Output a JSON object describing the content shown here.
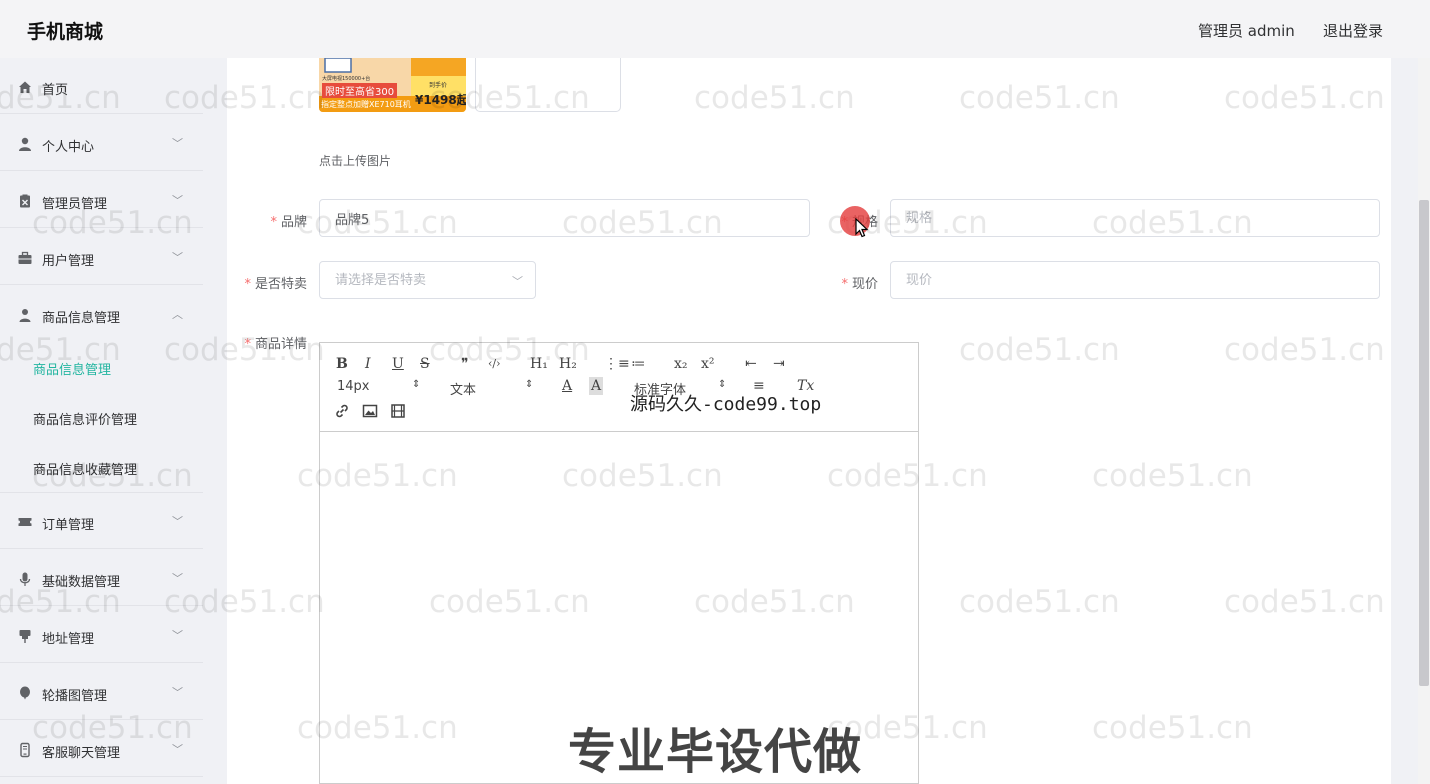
{
  "header": {
    "brand": "手机商城",
    "admin": "管理员 admin",
    "logout": "退出登录"
  },
  "sidebar": {
    "items": [
      {
        "label": "首页",
        "icon": "home-icon",
        "expand": ""
      },
      {
        "label": "个人中心",
        "icon": "user-icon",
        "expand": "﹀"
      },
      {
        "label": "管理员管理",
        "icon": "clipboard-icon",
        "expand": "﹀"
      },
      {
        "label": "用户管理",
        "icon": "briefcase-icon",
        "expand": "﹀"
      },
      {
        "label": "商品信息管理",
        "icon": "person-icon",
        "expand": "︿"
      },
      {
        "label": "订单管理",
        "icon": "ticket-icon",
        "expand": "﹀"
      },
      {
        "label": "基础数据管理",
        "icon": "mic-icon",
        "expand": "﹀"
      },
      {
        "label": "地址管理",
        "icon": "pin-icon",
        "expand": "﹀"
      },
      {
        "label": "轮播图管理",
        "icon": "balloon-icon",
        "expand": "﹀"
      },
      {
        "label": "客服聊天管理",
        "icon": "phone-icon",
        "expand": "﹀"
      }
    ],
    "sub_items": [
      {
        "label": "商品信息管理"
      },
      {
        "label": "商品信息评价管理"
      },
      {
        "label": "商品信息收藏管理"
      }
    ],
    "active_color": "#22b5a0"
  },
  "form": {
    "image": {
      "promo_line1": "大屏电视150000+台",
      "promo_line2": "限时至高省300",
      "promo_line3": "指定整点加赠XE710耳机",
      "promo_tag": "到手价",
      "promo_price": "¥1498起"
    },
    "upload_hint": "点击上传图片",
    "brand": {
      "label": "品牌",
      "value": "品牌5"
    },
    "spec": {
      "label": "规格",
      "placeholder": "规格"
    },
    "special": {
      "label": "是否特卖",
      "placeholder": "请选择是否特卖"
    },
    "price": {
      "label": "现价",
      "placeholder": "现价"
    },
    "detail": {
      "label": "商品详情"
    }
  },
  "editor": {
    "buttons": {
      "bold": "B",
      "italic": "I",
      "underline": "U",
      "strike": "S",
      "quote": "❞",
      "code": "‹/›",
      "h1": "H₁",
      "h2": "H₂",
      "ordered": "⋮≡",
      "bullet": "≔",
      "sub": "x₂",
      "sup": "x²",
      "outdent": "⇤",
      "indent": "⇥",
      "align": "≡",
      "clear": "Tx"
    },
    "font_size": "14px",
    "header": "文本",
    "font_family": "标准字体"
  },
  "watermark": "code51.cn",
  "overlay_top": "源码久久-code99.top",
  "overlay_bottom": "专业毕设代做"
}
